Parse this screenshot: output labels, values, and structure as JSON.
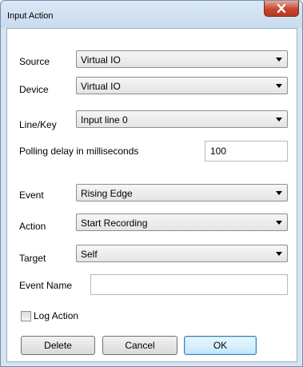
{
  "window": {
    "title": "Input Action"
  },
  "form": {
    "source": {
      "label": "Source",
      "value": "Virtual IO"
    },
    "device": {
      "label": "Device",
      "value": "Virtual IO"
    },
    "line_key": {
      "label": "Line/Key",
      "value": "Input line 0"
    },
    "polling_delay": {
      "label": "Polling delay in milliseconds",
      "value": "100"
    },
    "event": {
      "label": "Event",
      "value": "Rising Edge"
    },
    "action": {
      "label": "Action",
      "value": "Start Recording"
    },
    "target": {
      "label": "Target",
      "value": "Self"
    },
    "event_name": {
      "label": "Event Name",
      "value": ""
    },
    "log_action": {
      "label": "Log Action",
      "checked": false
    }
  },
  "buttons": {
    "delete": "Delete",
    "cancel": "Cancel",
    "ok": "OK"
  }
}
